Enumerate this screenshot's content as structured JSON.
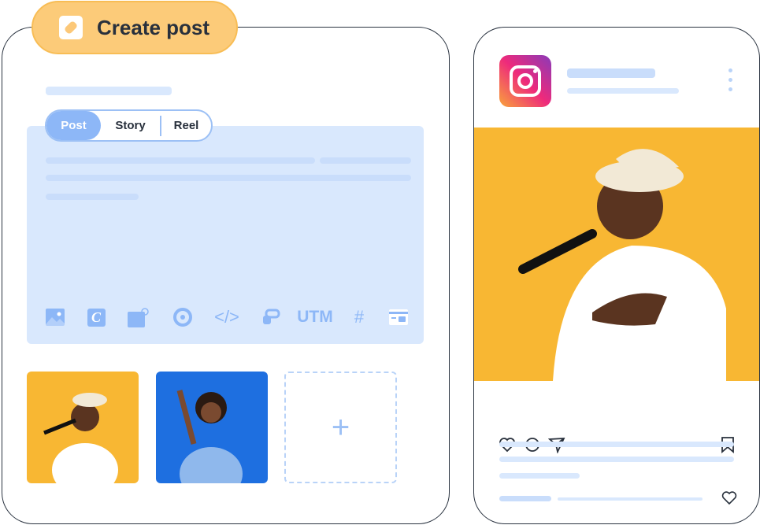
{
  "header": {
    "title": "Create post",
    "icon": "pencil-icon"
  },
  "composer": {
    "tabs": [
      {
        "label": "Post",
        "active": true
      },
      {
        "label": "Story",
        "active": false
      },
      {
        "label": "Reel",
        "active": false
      }
    ],
    "toolbar": [
      {
        "icon": "image-icon"
      },
      {
        "icon": "canva-icon",
        "label": "C"
      },
      {
        "icon": "image-search-icon"
      },
      {
        "icon": "target-icon"
      },
      {
        "icon": "code-icon",
        "label": "</>"
      },
      {
        "icon": "tap-icon"
      },
      {
        "icon": "utm-icon",
        "label": "UTM"
      },
      {
        "icon": "hashtag-icon",
        "label": "#"
      },
      {
        "icon": "card-icon"
      }
    ],
    "add_media_label": "+"
  },
  "preview": {
    "platform": "Instagram",
    "actions": [
      "heart-icon",
      "comment-icon",
      "share-icon",
      "bookmark-icon"
    ]
  },
  "colors": {
    "accent": "#8db7f7",
    "pill": "#fccb79",
    "editor": "#d9e8fd",
    "photo_bg": "#f8b733",
    "photo2_bg": "#1e6fe0"
  }
}
